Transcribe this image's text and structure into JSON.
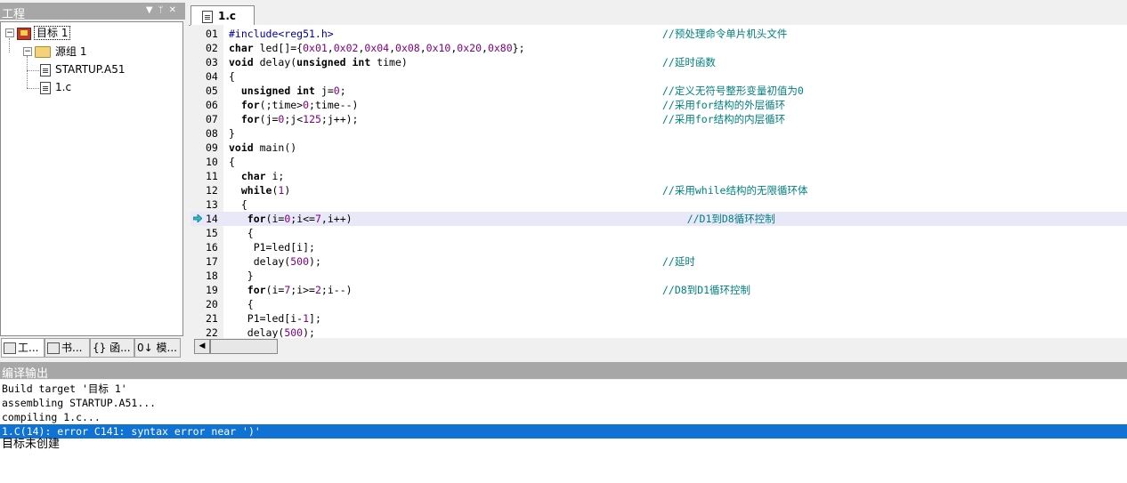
{
  "project_panel": {
    "title": "工程",
    "tree": [
      {
        "label": "目标 1",
        "icon": "target-icon"
      },
      {
        "label": "源组 1",
        "icon": "folder-icon"
      },
      {
        "label": "STARTUP.A51",
        "icon": "asm-file-icon"
      },
      {
        "label": "1.c",
        "icon": "c-file-icon"
      }
    ],
    "tabs": [
      "工...",
      "书...",
      "{} 函...",
      "0↓ 模..."
    ]
  },
  "editor": {
    "tab_label": "1.c",
    "current_line": "14",
    "lines": [
      {
        "num": "01",
        "code": "#include<reg51.h>",
        "comment": "//预处理命令单片机头文件"
      },
      {
        "num": "02",
        "code": "char led[]={0x01,0x02,0x04,0x08,0x10,0x20,0x80};",
        "comment": ""
      },
      {
        "num": "03",
        "code": "void delay(unsigned int time)",
        "comment": "//延时函数"
      },
      {
        "num": "04",
        "code": "{",
        "comment": ""
      },
      {
        "num": "05",
        "code": "  unsigned int j=0;",
        "comment": "//定义无符号整形变量初值为0"
      },
      {
        "num": "06",
        "code": "  for(;time>0;time--)",
        "comment": "//采用for结构的外层循环"
      },
      {
        "num": "07",
        "code": "  for(j=0;j<125;j++);",
        "comment": "//采用for结构的内层循环"
      },
      {
        "num": "08",
        "code": "}",
        "comment": ""
      },
      {
        "num": "09",
        "code": "void main()",
        "comment": ""
      },
      {
        "num": "10",
        "code": "{",
        "comment": ""
      },
      {
        "num": "11",
        "code": "  char i;",
        "comment": ""
      },
      {
        "num": "12",
        "code": "  while(1)",
        "comment": "//采用while结构的无限循环体"
      },
      {
        "num": "13",
        "code": "  {",
        "comment": ""
      },
      {
        "num": "14",
        "code": "   for(i=0;i<=7,i++)",
        "comment": "    //D1到D8循环控制"
      },
      {
        "num": "15",
        "code": "   {",
        "comment": ""
      },
      {
        "num": "16",
        "code": "    P1=led[i];",
        "comment": ""
      },
      {
        "num": "17",
        "code": "    delay(500);",
        "comment": "//延时"
      },
      {
        "num": "18",
        "code": "   }",
        "comment": ""
      },
      {
        "num": "19",
        "code": "   for(i=7;i>=2;i--)",
        "comment": "//D8到D1循环控制"
      },
      {
        "num": "20",
        "code": "   {",
        "comment": ""
      },
      {
        "num": "21",
        "code": "   P1=led[i-1];",
        "comment": ""
      },
      {
        "num": "22",
        "code": "   delay(500);",
        "comment": ""
      }
    ]
  },
  "output": {
    "title": "编译输出",
    "lines": [
      "Build target '目标 1'",
      "assembling STARTUP.A51...",
      "compiling 1.c...",
      "1.C(14): error C141: syntax error near ')'",
      "目标未创建"
    ]
  },
  "colors": {
    "comment": "#008080",
    "highlight_line": "#e8e8f8",
    "error_selection": "#1072d4",
    "panel_title": "#a7a7a7"
  }
}
